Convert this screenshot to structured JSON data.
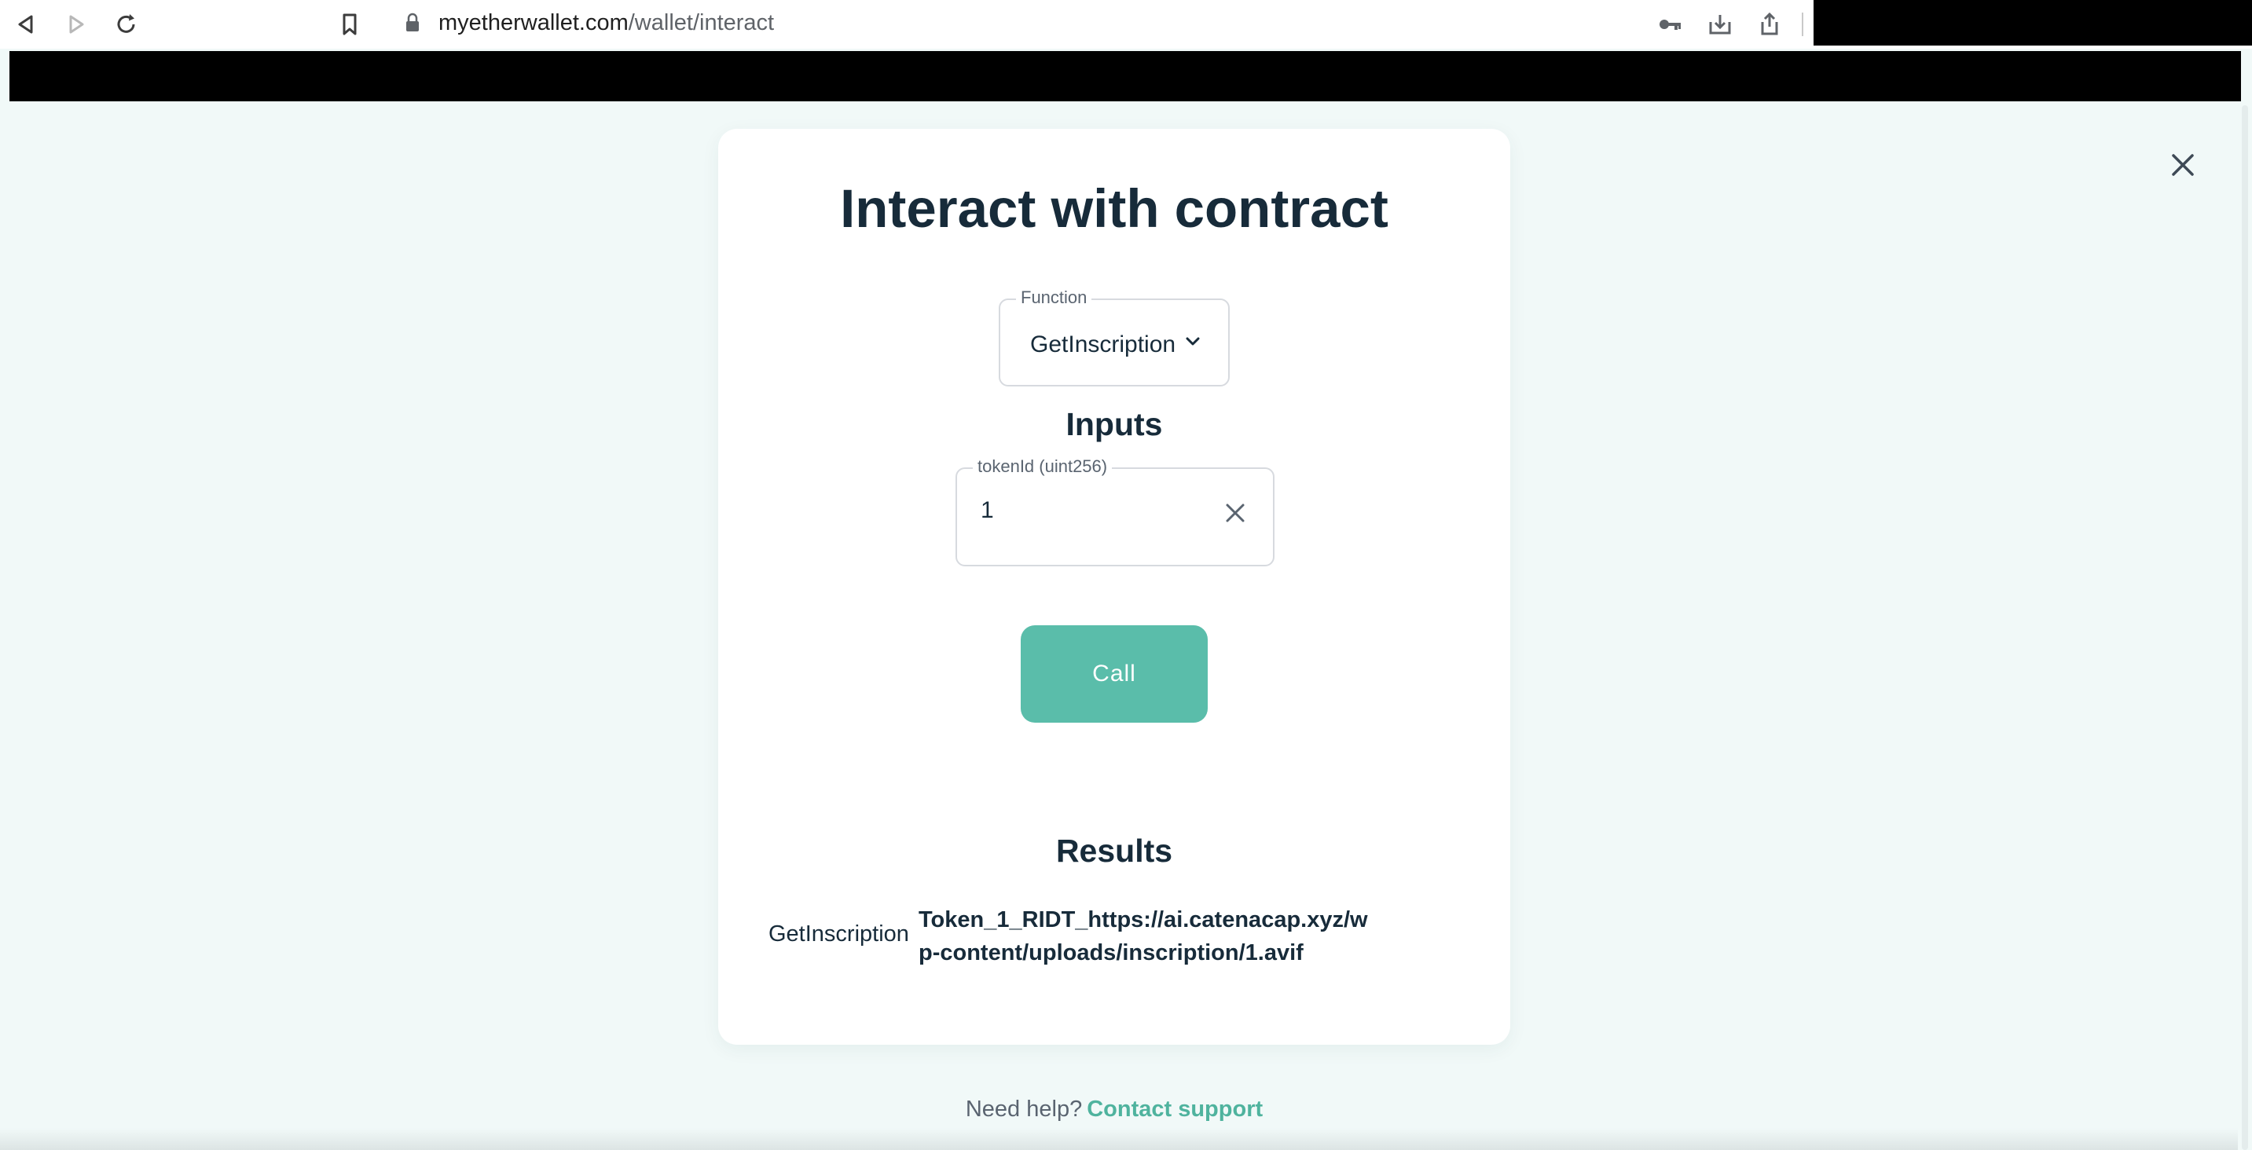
{
  "browser": {
    "url_domain": "myetherwallet.com",
    "url_path": "/wallet/interact"
  },
  "modal": {
    "title": "Interact with contract",
    "function_field": {
      "label": "Function",
      "value": "GetInscription"
    },
    "inputs_heading": "Inputs",
    "token_field": {
      "label": "tokenId (uint256)",
      "value": "1"
    },
    "call_button": "Call",
    "results_heading": "Results",
    "result": {
      "label": "GetInscription",
      "value": "Token_1_RIDT_https://ai.catenacap.xyz/wp-content/uploads/inscription/1.avif"
    }
  },
  "help": {
    "text": "Need help?",
    "link": "Contact support"
  },
  "colors": {
    "accent": "#5abdaa",
    "link": "#4fb39e",
    "background": "#f1f9f8",
    "heading": "#172b3a"
  },
  "icons": [
    "back-icon",
    "forward-icon",
    "reload-icon",
    "bookmark-icon",
    "lock-icon",
    "key-icon",
    "download-icon",
    "share-icon",
    "close-icon",
    "chevron-down-icon",
    "clear-icon"
  ]
}
